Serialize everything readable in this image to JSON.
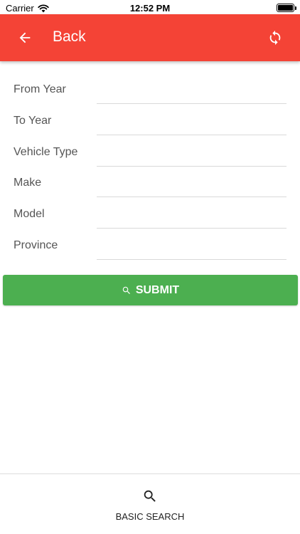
{
  "status_bar": {
    "carrier": "Carrier",
    "time": "12:52 PM"
  },
  "header": {
    "back_label": "Back",
    "back_icon": "arrow-left-icon",
    "refresh_icon": "refresh-icon",
    "color": "#f44336"
  },
  "form": {
    "fields": [
      {
        "label": "From Year",
        "value": ""
      },
      {
        "label": "To Year",
        "value": ""
      },
      {
        "label": "Vehicle Type",
        "value": ""
      },
      {
        "label": "Make",
        "value": ""
      },
      {
        "label": "Model",
        "value": ""
      },
      {
        "label": "Province",
        "value": ""
      }
    ]
  },
  "submit": {
    "label": "SUBMIT",
    "icon": "search-icon",
    "color": "#4caf50"
  },
  "tab_bar": {
    "items": [
      {
        "label": "BASIC SEARCH",
        "icon": "search-icon"
      }
    ]
  }
}
